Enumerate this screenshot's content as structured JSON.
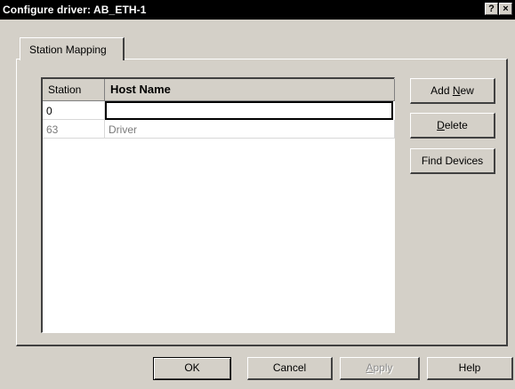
{
  "window": {
    "title": "Configure driver: AB_ETH-1",
    "help_glyph": "?",
    "close_glyph": "×"
  },
  "tab": {
    "label": "Station Mapping"
  },
  "grid": {
    "columns": [
      "Station",
      "Host Name"
    ],
    "rows": [
      {
        "station": "0",
        "host": ""
      },
      {
        "station": "63",
        "host": "Driver"
      }
    ]
  },
  "buttons": {
    "add_new": {
      "pre": "Add ",
      "mnemonic": "N",
      "post": "ew"
    },
    "delete": {
      "pre": "",
      "mnemonic": "D",
      "post": "elete"
    },
    "find_devices": "Find Devices",
    "ok": "OK",
    "cancel": "Cancel",
    "apply": {
      "pre": "",
      "mnemonic": "A",
      "post": "pply"
    },
    "help": "Help"
  },
  "colors": {
    "face": "#d4d0c8",
    "titlebar": "#000000",
    "disabled_text": "#8c8c8c"
  }
}
